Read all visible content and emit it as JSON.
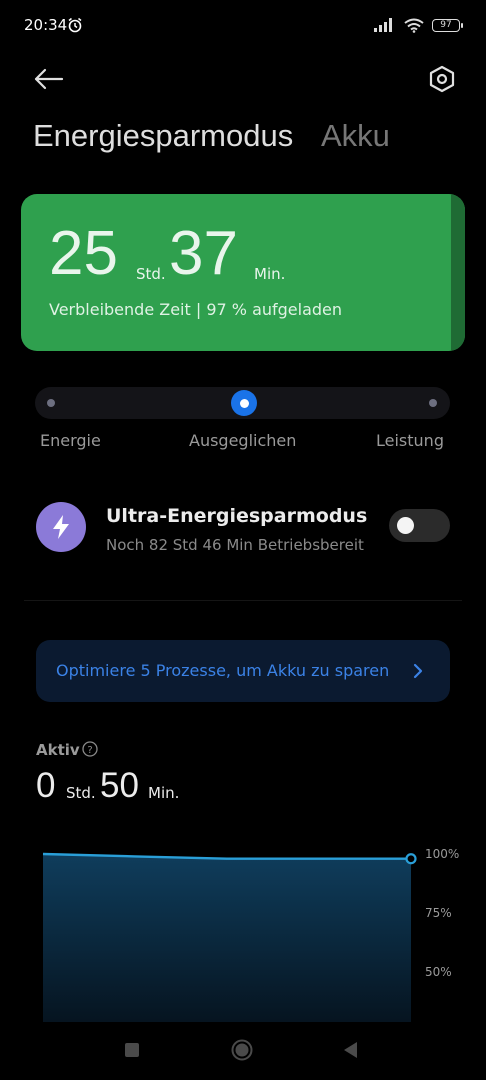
{
  "status_bar": {
    "time": "20:34",
    "alarm_icon": "alarm-clock-icon",
    "signal_icon": "cellular-signal-icon",
    "wifi_icon": "wifi-icon",
    "battery_level": "97"
  },
  "header": {
    "back_icon": "arrow-left-icon",
    "settings_icon": "hexagon-gear-icon",
    "tabs": [
      {
        "label": "Energiesparmodus",
        "active": true
      },
      {
        "label": "Akku",
        "active": false
      }
    ]
  },
  "battery_card": {
    "hours": "25",
    "hours_unit": "Std.",
    "minutes": "37",
    "minutes_unit": "Min.",
    "subtitle": "Verbleibende Zeit | 97 % aufgeladen",
    "color": "#2fa04e"
  },
  "mode_slider": {
    "modes": [
      "Energie",
      "Ausgeglichen",
      "Leistung"
    ],
    "selected": "Ausgeglichen",
    "accent": "#1a73e8"
  },
  "ultra_saver": {
    "icon": "lightning-bolt-icon",
    "title": "Ultra-Energiesparmodus",
    "subtitle": "Noch 82 Std 46 Min Betriebsbereit",
    "enabled": false
  },
  "optimize_banner": {
    "text": "Optimiere 5 Prozesse, um Akku zu sparen",
    "icon": "chevron-right-icon"
  },
  "active_usage": {
    "label": "Aktiv",
    "help_icon": "question-circle-icon",
    "hours": "0",
    "hours_unit": "Std.",
    "minutes": "50",
    "minutes_unit": "Min."
  },
  "chart_data": {
    "type": "area",
    "y_ticks": [
      "100%",
      "75%",
      "50%"
    ],
    "ylim": [
      40,
      100
    ],
    "x": [
      0,
      0.25,
      0.5,
      0.75,
      1
    ],
    "values": [
      100,
      99,
      98,
      98,
      98
    ],
    "color": "#2a9fd8"
  },
  "nav_bar": {
    "recents_icon": "square-recents-icon",
    "home_icon": "circle-home-icon",
    "back_icon": "triangle-back-icon"
  }
}
